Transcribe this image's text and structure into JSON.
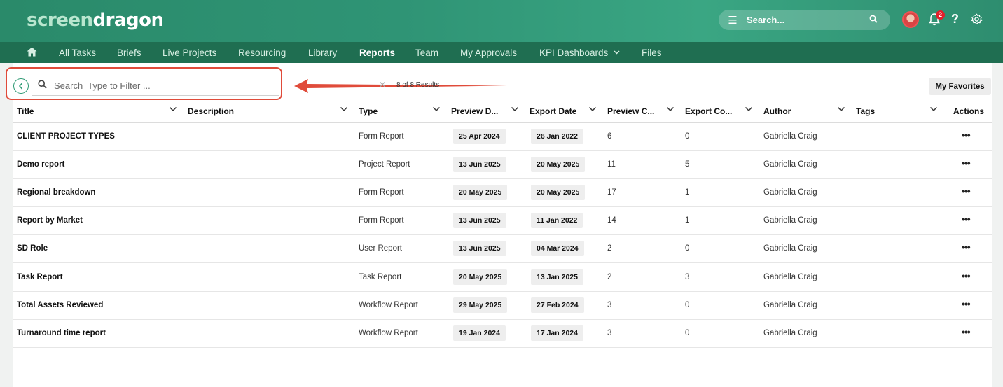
{
  "brand": {
    "part1": "screen",
    "part2": "dragon"
  },
  "top_search": {
    "label": "Search..."
  },
  "notifications": {
    "count": "2"
  },
  "nav": {
    "items": [
      {
        "label": "All Tasks",
        "active": false
      },
      {
        "label": "Briefs",
        "active": false
      },
      {
        "label": "Live Projects",
        "active": false
      },
      {
        "label": "Resourcing",
        "active": false
      },
      {
        "label": "Library",
        "active": false
      },
      {
        "label": "Reports",
        "active": true
      },
      {
        "label": "Team",
        "active": false
      },
      {
        "label": "My Approvals",
        "active": false
      },
      {
        "label": "KPI Dashboards",
        "active": false
      },
      {
        "label": "Files",
        "active": false
      }
    ]
  },
  "filter": {
    "placeholder": "Search  Type to Filter ...",
    "results": "8 of 8 Results"
  },
  "favorites_label": "My Favorites",
  "columns": [
    "Title",
    "Description",
    "Type",
    "Preview D...",
    "Export Date",
    "Preview C...",
    "Export Co...",
    "Author",
    "Tags",
    "Actions"
  ],
  "rows": [
    {
      "title": "CLIENT PROJECT TYPES",
      "type": "Form Report",
      "preview_date": "25 Apr 2024",
      "export_date": "26 Jan 2022",
      "preview_count": "6",
      "export_count": "0",
      "author": "Gabriella Craig"
    },
    {
      "title": "Demo report",
      "type": "Project Report",
      "preview_date": "13 Jun 2025",
      "export_date": "20 May 2025",
      "preview_count": "11",
      "export_count": "5",
      "author": "Gabriella Craig"
    },
    {
      "title": "Regional breakdown",
      "type": "Form Report",
      "preview_date": "20 May 2025",
      "export_date": "20 May 2025",
      "preview_count": "17",
      "export_count": "1",
      "author": "Gabriella Craig"
    },
    {
      "title": "Report by Market",
      "type": "Form Report",
      "preview_date": "13 Jun 2025",
      "export_date": "11 Jan 2022",
      "preview_count": "14",
      "export_count": "1",
      "author": "Gabriella Craig"
    },
    {
      "title": "SD Role",
      "type": "User Report",
      "preview_date": "13 Jun 2025",
      "export_date": "04 Mar 2024",
      "preview_count": "2",
      "export_count": "0",
      "author": "Gabriella Craig"
    },
    {
      "title": "Task Report",
      "type": "Task Report",
      "preview_date": "20 May 2025",
      "export_date": "13 Jan 2025",
      "preview_count": "2",
      "export_count": "3",
      "author": "Gabriella Craig"
    },
    {
      "title": "Total Assets Reviewed",
      "type": "Workflow Report",
      "preview_date": "29 May 2025",
      "export_date": "27 Feb 2024",
      "preview_count": "3",
      "export_count": "0",
      "author": "Gabriella Craig"
    },
    {
      "title": "Turnaround time report",
      "type": "Workflow Report",
      "preview_date": "19 Jan 2024",
      "export_date": "17 Jan 2024",
      "preview_count": "3",
      "export_count": "0",
      "author": "Gabriella Craig"
    }
  ],
  "actions_glyph": "•••",
  "colors": {
    "brand_green": "#2f9475",
    "nav_green": "#1f6e51",
    "highlight_red": "#e04b3a"
  }
}
